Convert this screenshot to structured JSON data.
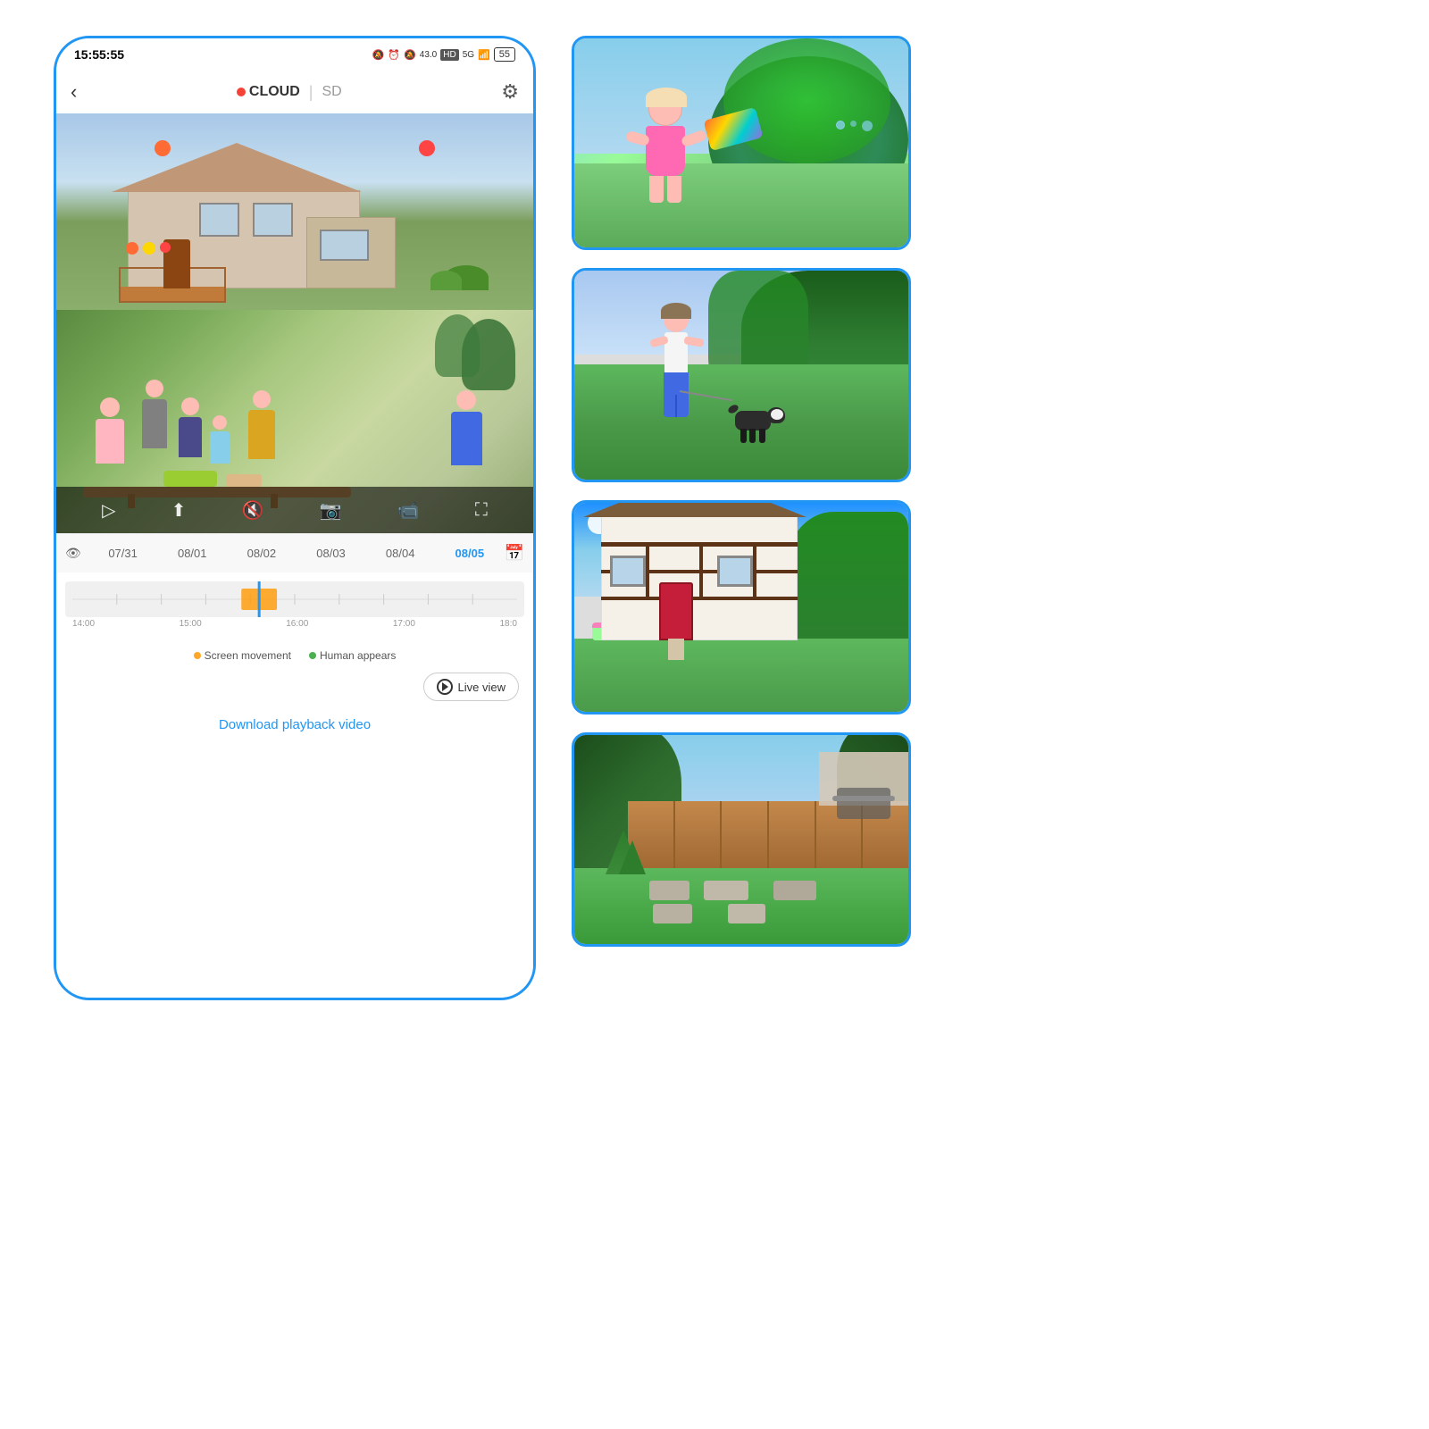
{
  "status_bar": {
    "time": "15:55:55",
    "icons": "🔔 ⏰ 🔇 43.0 HD 5G 📶 55"
  },
  "nav": {
    "back_label": "‹",
    "cloud_label": "CLOUD",
    "divider": "|",
    "sd_label": "SD",
    "settings_icon": "⚙"
  },
  "dates": {
    "items": [
      "07/31",
      "08/01",
      "08/02",
      "08/03",
      "08/04",
      "08/05"
    ],
    "active_index": 5
  },
  "timeline": {
    "labels": [
      "14:00",
      "15:00",
      "16:00",
      "17:00",
      "18:0"
    ]
  },
  "controls": {
    "play": "▷",
    "export": "⬆",
    "mute": "🔇",
    "screenshot": "📷",
    "record": "📹",
    "fullscreen": "⛶"
  },
  "legend": {
    "screen_movement_label": "Screen movement",
    "screen_movement_color": "#FFA726",
    "human_appears_label": "Human appears",
    "human_appears_color": "#4CAF50"
  },
  "live_view": {
    "label": "Live view"
  },
  "download": {
    "label": "Download playback video"
  },
  "thumbnails": [
    {
      "id": 1,
      "alt": "Girl with water gun",
      "scene": "girl_water_gun"
    },
    {
      "id": 2,
      "alt": "Woman walking dog",
      "scene": "woman_dog"
    },
    {
      "id": 3,
      "alt": "Tudor house exterior",
      "scene": "tudor_house"
    },
    {
      "id": 4,
      "alt": "Backyard garden",
      "scene": "backyard_garden"
    }
  ]
}
